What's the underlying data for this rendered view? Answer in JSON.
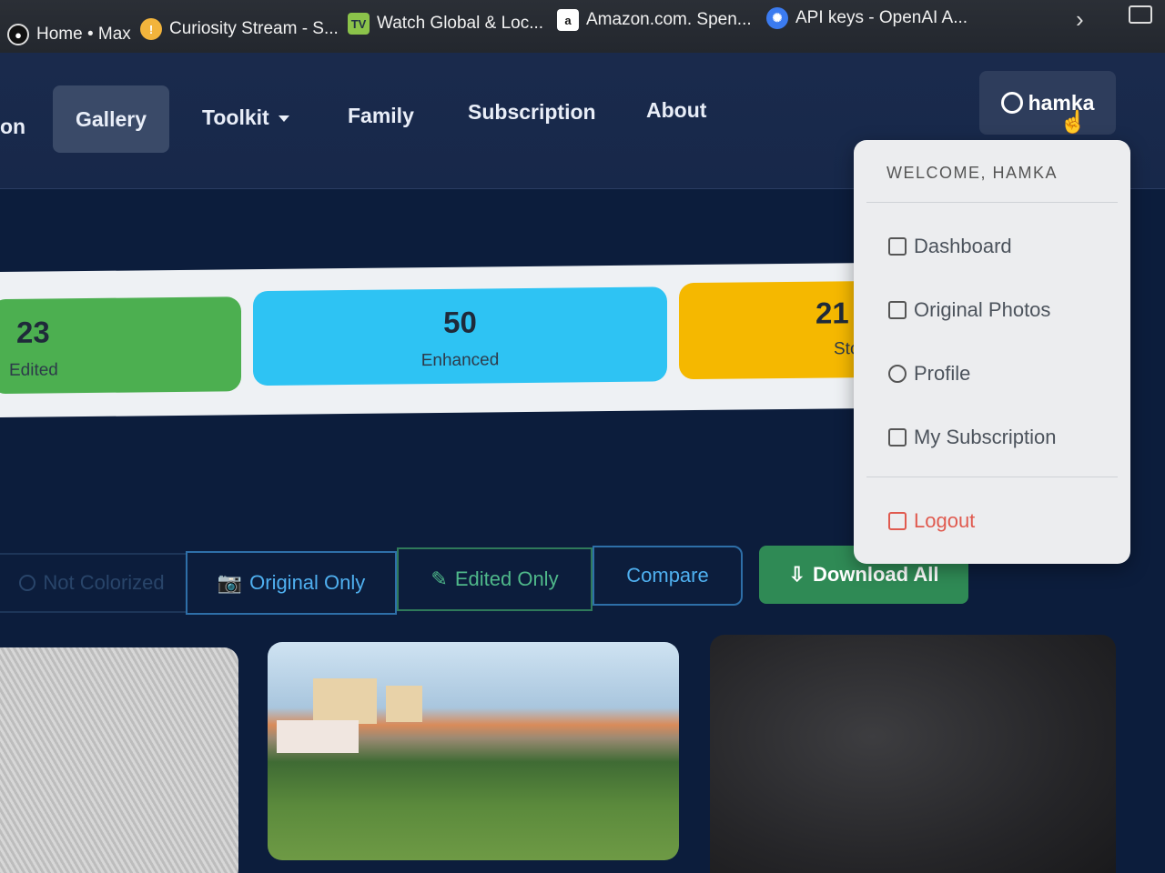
{
  "bookmarks": [
    {
      "label": "Home • Max",
      "icon": "max-icon"
    },
    {
      "label": "Curiosity Stream - S...",
      "icon": "curiosity-icon"
    },
    {
      "label": "Watch Global & Loc...",
      "icon": "tv-icon"
    },
    {
      "label": "Amazon.com. Spen...",
      "icon": "amazon-icon"
    },
    {
      "label": "API keys - OpenAI A...",
      "icon": "openai-icon"
    }
  ],
  "nav": {
    "brand_fragment": "on",
    "gallery": "Gallery",
    "toolkit": "Toolkit",
    "family": "Family",
    "subscription": "Subscription",
    "about": "About",
    "user": "hamka"
  },
  "stats": {
    "edited": {
      "value": "23",
      "label": "Edited"
    },
    "enhanced": {
      "value": "50",
      "label": "Enhanced"
    },
    "stored": {
      "value": "21",
      "label": "Sto"
    }
  },
  "filters": {
    "not_colorized": "Not Colorized",
    "original_only": "Original Only",
    "edited_only": "Edited Only",
    "compare": "Compare",
    "download_all": "Download All"
  },
  "dropdown": {
    "welcome": "WELCOME, HAMKA",
    "dashboard": "Dashboard",
    "original_photos": "Original Photos",
    "profile": "Profile",
    "my_subscription": "My Subscription",
    "logout": "Logout"
  },
  "colors": {
    "edited": "#4caf50",
    "enhanced": "#2ec3f3",
    "stored": "#f5b800",
    "download": "#2f8a55",
    "logout": "#e05a4f"
  }
}
